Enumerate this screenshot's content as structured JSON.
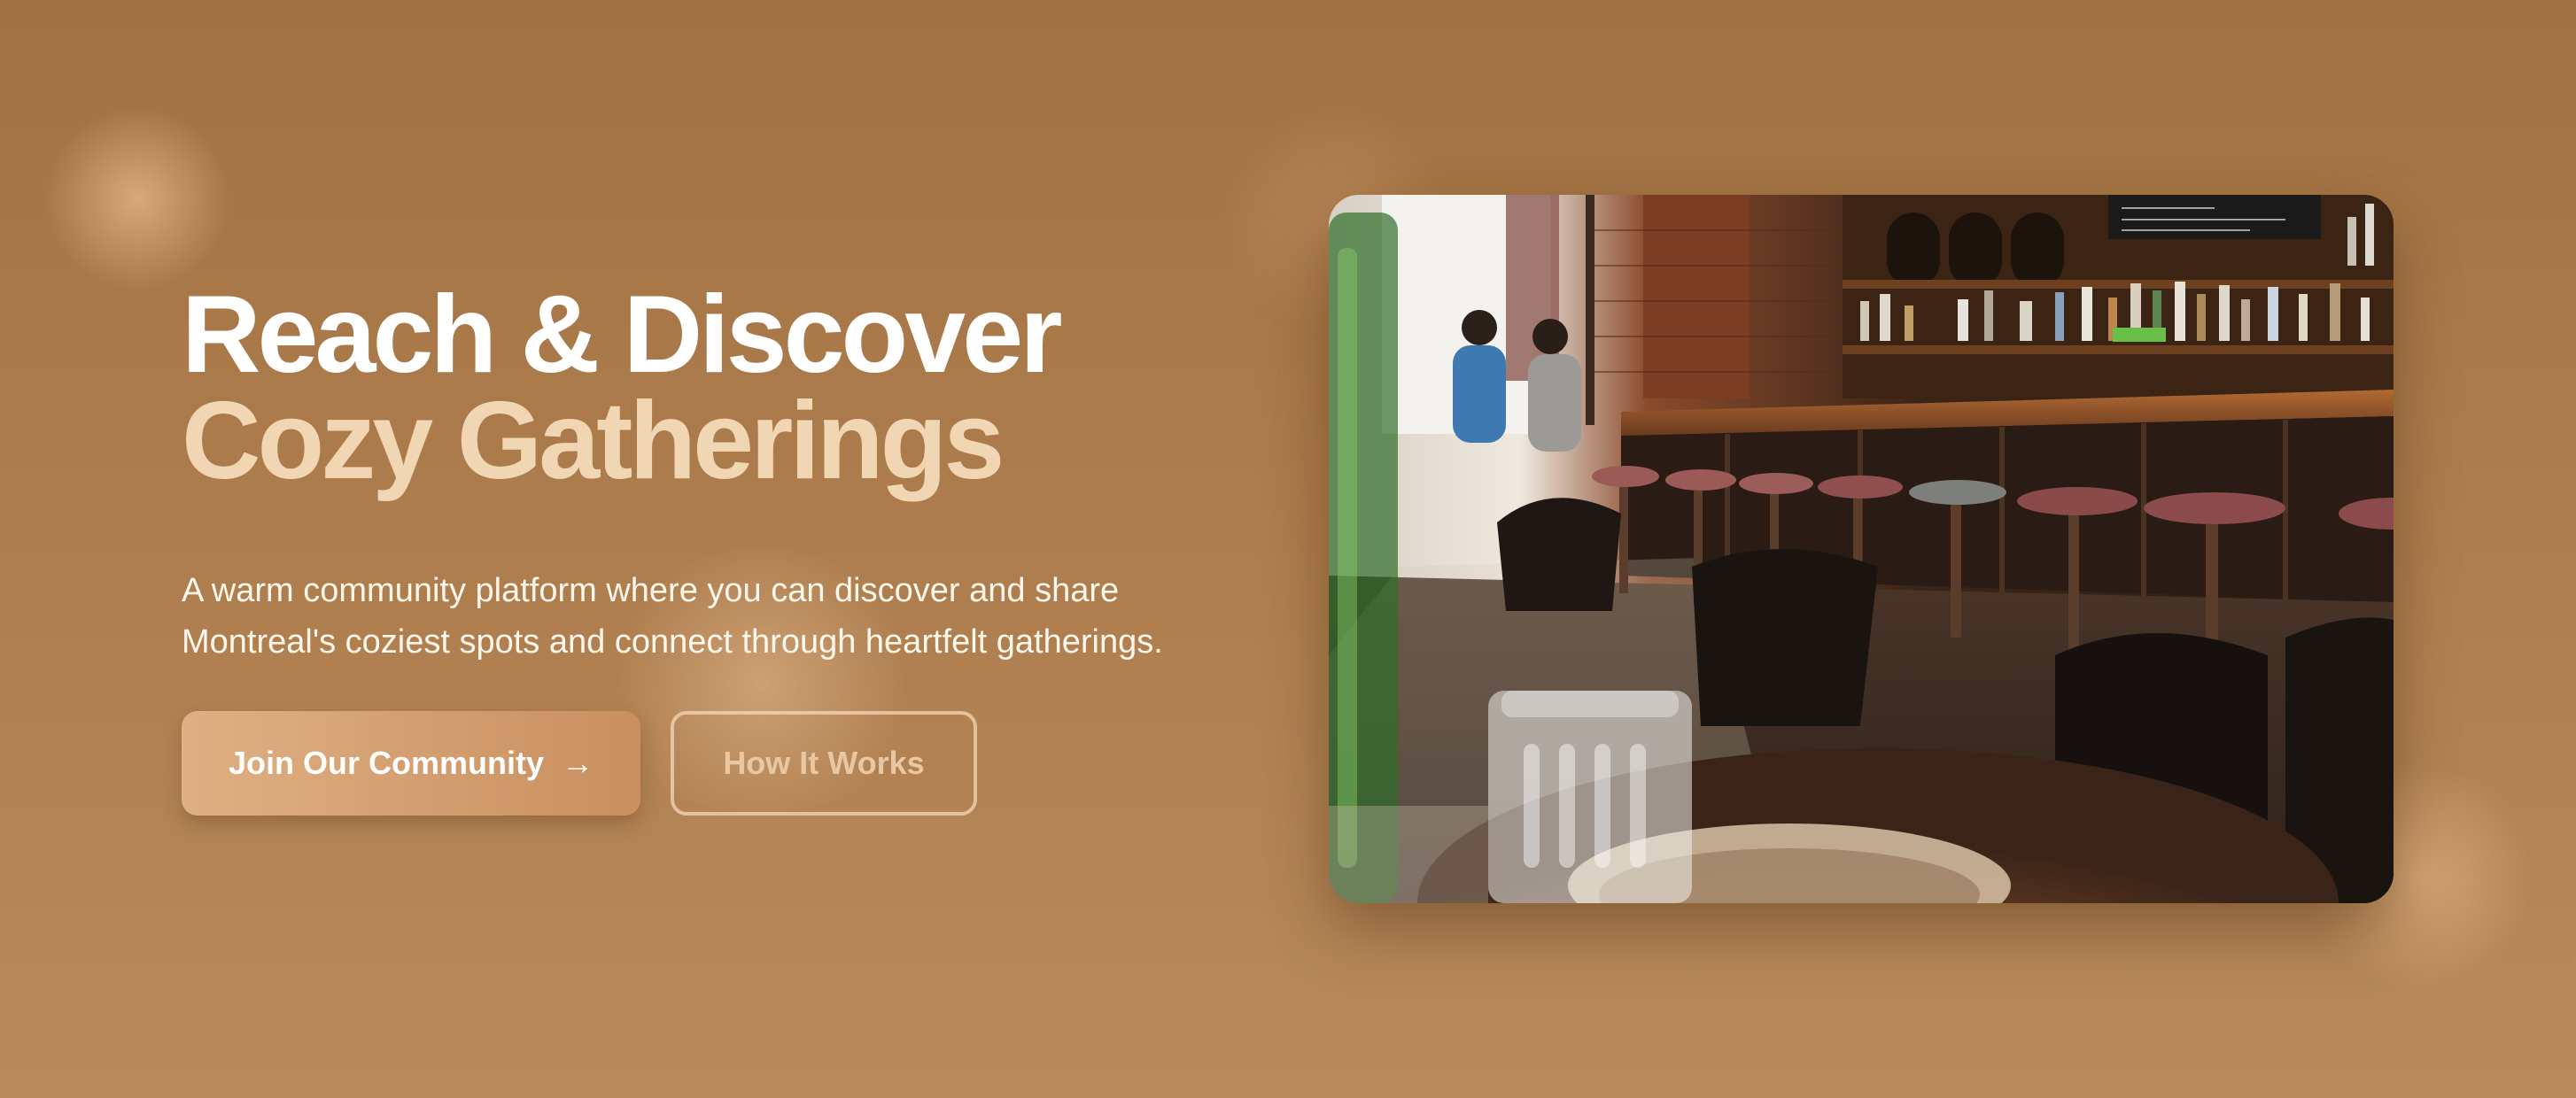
{
  "hero": {
    "title_line1": "Reach & Discover",
    "title_line2": "Cozy Gatherings",
    "description": "A warm community platform where you can discover and share Montreal's coziest spots and connect through heartfelt gatherings.",
    "primary_cta": "Join Our Community",
    "primary_cta_icon": "arrow-right-icon",
    "secondary_cta": "How It Works"
  },
  "image": {
    "alt": "Cafe bar interior with stools, wooden bar counter and shelves of bottles"
  },
  "colors": {
    "background": "#a97848",
    "title_primary": "#ffffff",
    "title_accent": "#f1d6b4",
    "cta_primary": "#d6a274"
  }
}
